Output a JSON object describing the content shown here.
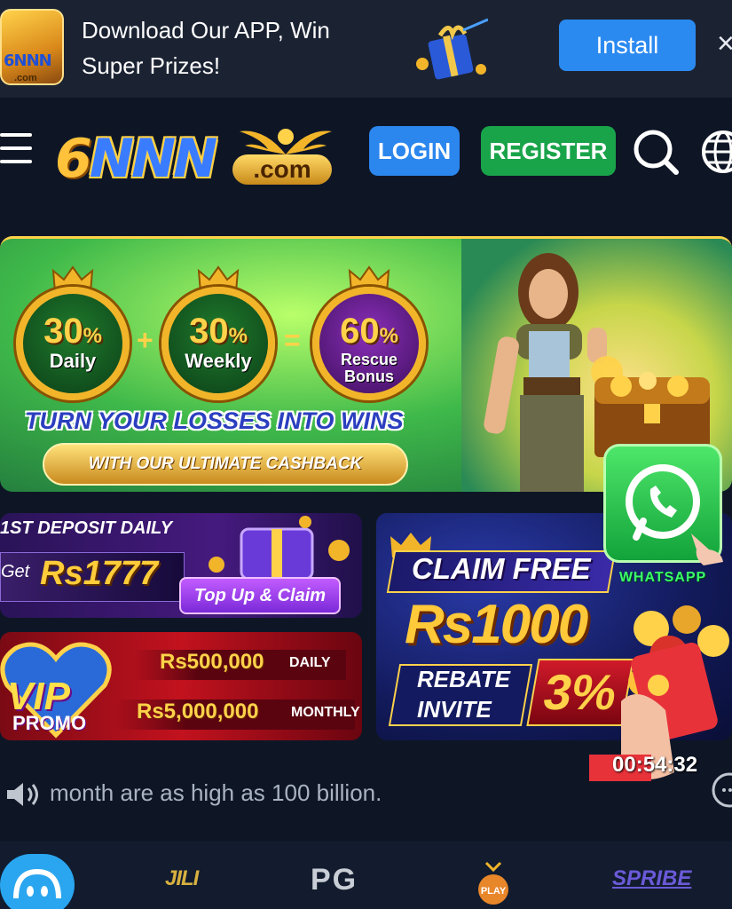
{
  "app_banner": {
    "logo_text": "6NNN",
    "logo_sub": ".com",
    "message": "Download Our APP, Win Super Prizes!",
    "install_label": "Install",
    "close_glyph": "×"
  },
  "header": {
    "logo_six": "6",
    "logo_nnn": "NNN",
    "logo_com": ".com",
    "login_label": "LOGIN",
    "register_label": "REGISTER",
    "icons": [
      "menu-icon",
      "search-icon",
      "globe-icon"
    ]
  },
  "hero": {
    "medals": [
      {
        "pct": "30",
        "unit": "%",
        "label": "Daily"
      },
      {
        "pct": "30",
        "unit": "%",
        "label": "Weekly"
      },
      {
        "pct": "60",
        "unit": "%",
        "label_line1": "Rescue",
        "label_line2": "Bonus"
      }
    ],
    "plus": "+",
    "equals": "=",
    "headline": "TURN YOUR LOSSES INTO WINS",
    "subline": "WITH OUR ULTIMATE CASHBACK"
  },
  "promo_deposit": {
    "title": "1ST DEPOSIT DAILY",
    "get": "Get",
    "amount": "Rs1777",
    "button": "Top Up & Claim"
  },
  "promo_vip": {
    "vip": "VIP",
    "promo": "PROMO",
    "daily_amount": "Rs500,000",
    "daily_label": "DAILY",
    "monthly_amount": "Rs5,000,000",
    "monthly_label": "MONTHLY"
  },
  "promo_claim": {
    "claim_free": "CLAIM FREE",
    "amount": "Rs1000",
    "rebate": "REBATE",
    "invite": "INVITE",
    "percent": "3%"
  },
  "whatsapp": {
    "label": "WHATSAPP"
  },
  "timer": {
    "value": "00:54:32"
  },
  "marquee": {
    "text": "month are as high as 100 billion."
  },
  "providers": [
    "JILI",
    "PG",
    "PLAY",
    "SPRIBE"
  ],
  "colors": {
    "bg": "#0e1626",
    "login": "#2b86ee",
    "register": "#1aa44a",
    "install": "#2b8af0"
  }
}
